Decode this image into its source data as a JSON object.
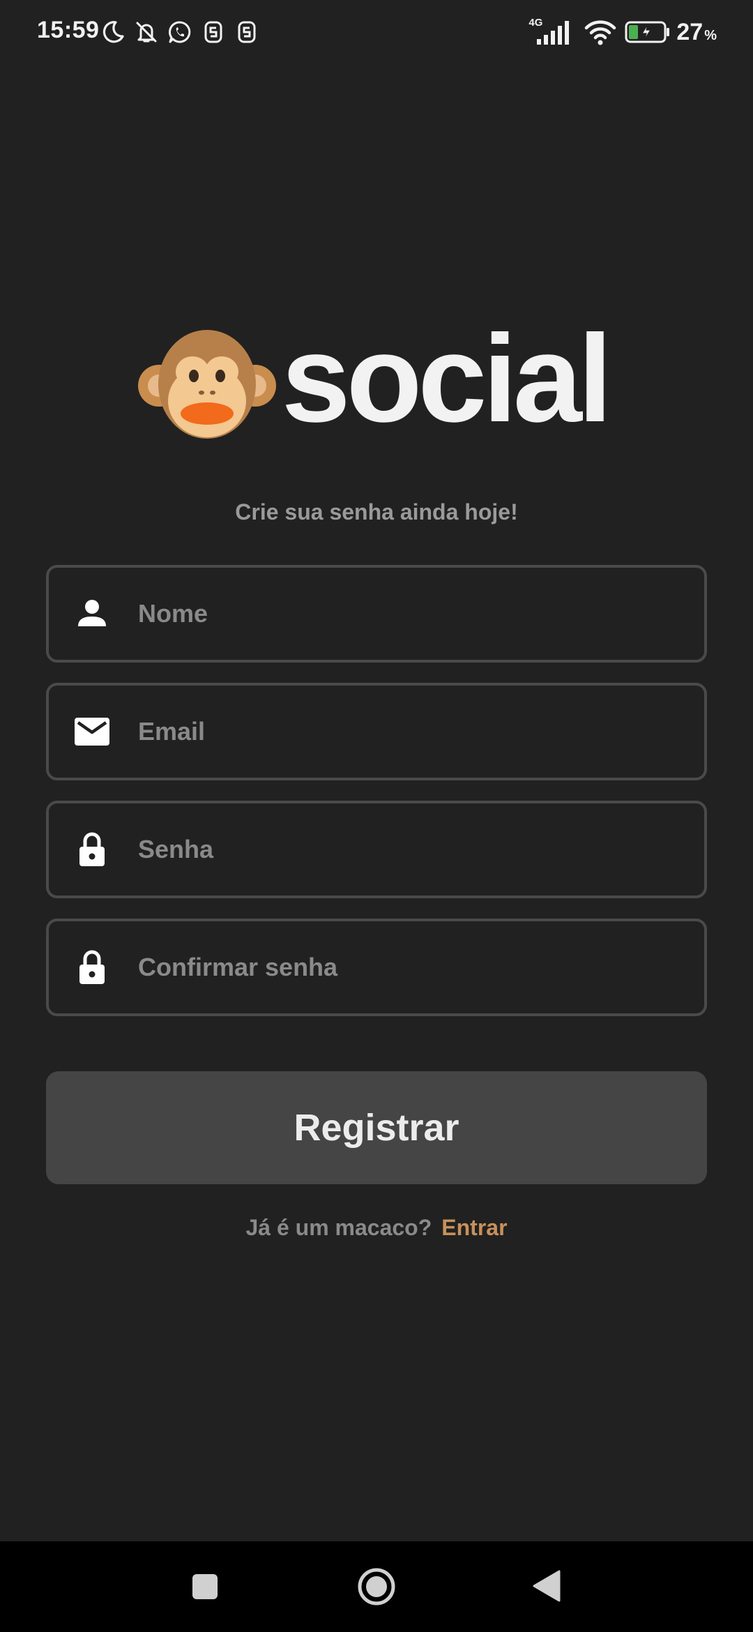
{
  "status_bar": {
    "time": "15:59",
    "network": "4G",
    "battery_percent": "27",
    "battery_unit": "%",
    "icons": [
      "moon-icon",
      "bell-off-icon",
      "whatsapp-icon",
      "app-s-icon",
      "app-s-icon",
      "signal-icon",
      "wifi-icon",
      "battery-charging-icon"
    ],
    "battery_fill_fraction": 0.27,
    "battery_fill_color": "#4caf50"
  },
  "logo": {
    "icon": "monkey-face-icon",
    "text": "social"
  },
  "tagline": "Crie sua senha ainda hoje!",
  "form": {
    "name": {
      "icon": "person-icon",
      "placeholder": "Nome",
      "value": ""
    },
    "email": {
      "icon": "mail-icon",
      "placeholder": "Email",
      "value": ""
    },
    "password": {
      "icon": "lock-icon",
      "placeholder": "Senha",
      "value": ""
    },
    "confirm_password": {
      "icon": "lock-icon",
      "placeholder": "Confirmar senha",
      "value": ""
    },
    "submit_label": "Registrar"
  },
  "login": {
    "prompt": "Já é um macaco?",
    "link_label": "Entrar"
  },
  "nav": {
    "icons": [
      "recent-apps-icon",
      "home-icon",
      "back-icon"
    ]
  },
  "colors": {
    "background": "#212121",
    "field_border": "#4a4a4a",
    "button_bg": "#454545",
    "link": "#c8915a",
    "placeholder": "#8a8a8a"
  }
}
